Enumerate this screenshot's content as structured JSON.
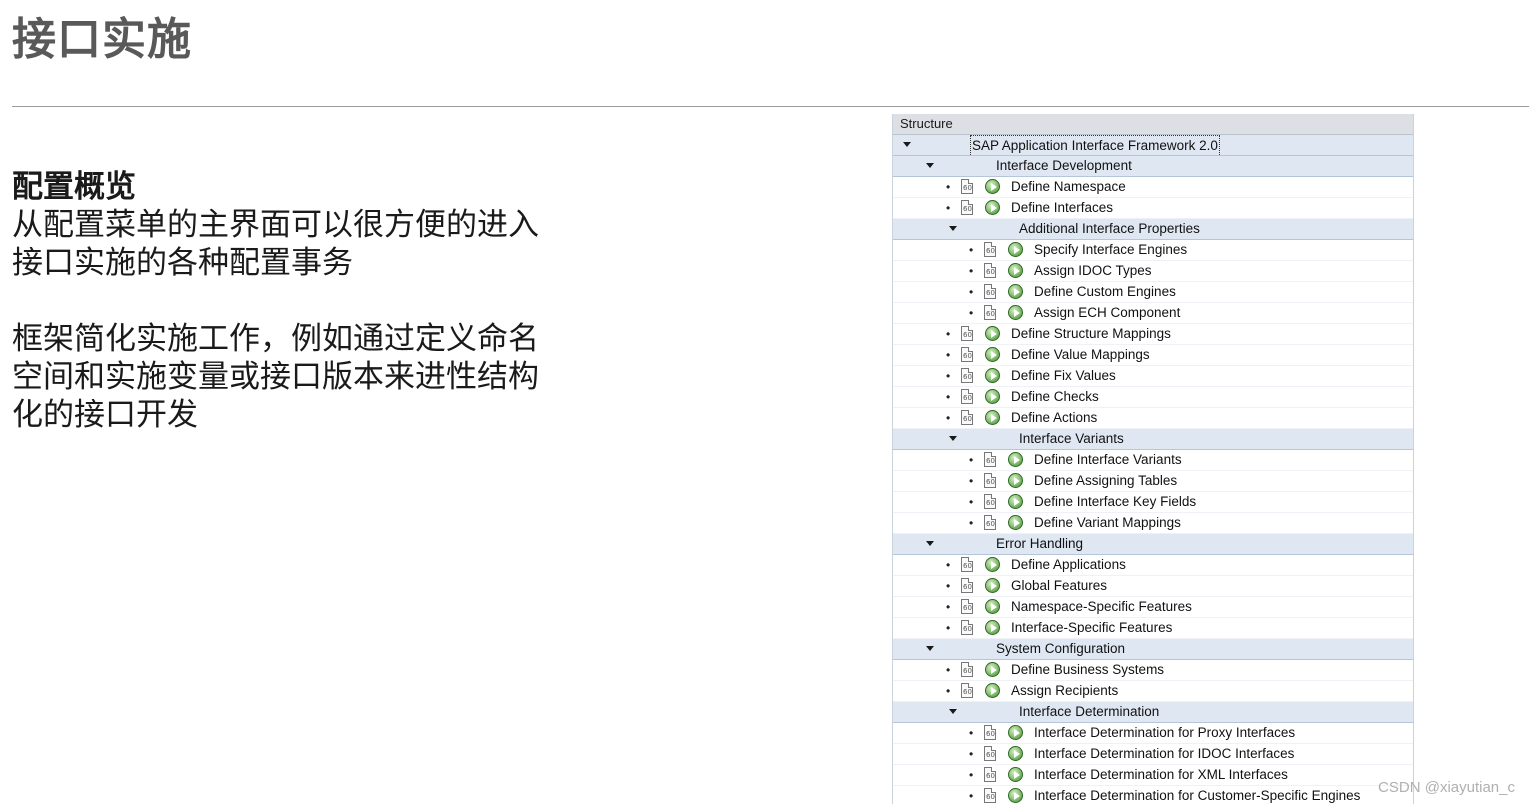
{
  "page": {
    "title": "接口实施",
    "section_heading": "配置概览",
    "paragraphs": [
      "从配置菜单的主界面可以很方便的进入接口实施的各种配置事务",
      "框架简化实施工作，例如通过定义命名空间和实施变量或接口版本来进性结构化的接口开发"
    ],
    "para_lines": [
      [
        "从配置菜单的主界面可以很方便的进入",
        "接口实施的各种配置事务"
      ],
      [
        "框架简化实施工作，例如通过定义命名",
        "空间和实施变量或接口版本来进性结构",
        "化的接口开发"
      ]
    ]
  },
  "tree": {
    "header": "Structure",
    "rows": [
      {
        "label": "SAP Application Interface Framework 2.0",
        "level": 0,
        "kind": "folder",
        "expanded": true
      },
      {
        "label": "Interface Development",
        "level": 1,
        "kind": "folder",
        "expanded": true
      },
      {
        "label": "Define Namespace",
        "level": 2,
        "kind": "item"
      },
      {
        "label": "Define Interfaces",
        "level": 2,
        "kind": "item"
      },
      {
        "label": "Additional Interface Properties",
        "level": 2,
        "kind": "folder",
        "expanded": true
      },
      {
        "label": "Specify Interface Engines",
        "level": 3,
        "kind": "item"
      },
      {
        "label": "Assign IDOC Types",
        "level": 3,
        "kind": "item"
      },
      {
        "label": "Define Custom Engines",
        "level": 3,
        "kind": "item"
      },
      {
        "label": "Assign ECH Component",
        "level": 3,
        "kind": "item"
      },
      {
        "label": "Define Structure Mappings",
        "level": 2,
        "kind": "item"
      },
      {
        "label": "Define Value Mappings",
        "level": 2,
        "kind": "item"
      },
      {
        "label": "Define Fix Values",
        "level": 2,
        "kind": "item"
      },
      {
        "label": "Define Checks",
        "level": 2,
        "kind": "item"
      },
      {
        "label": "Define Actions",
        "level": 2,
        "kind": "item"
      },
      {
        "label": "Interface Variants",
        "level": 2,
        "kind": "folder",
        "expanded": true
      },
      {
        "label": "Define Interface Variants",
        "level": 3,
        "kind": "item"
      },
      {
        "label": "Define Assigning Tables",
        "level": 3,
        "kind": "item"
      },
      {
        "label": "Define Interface Key Fields",
        "level": 3,
        "kind": "item"
      },
      {
        "label": "Define Variant Mappings",
        "level": 3,
        "kind": "item"
      },
      {
        "label": "Error Handling",
        "level": 1,
        "kind": "folder",
        "expanded": true
      },
      {
        "label": "Define Applications",
        "level": 2,
        "kind": "item"
      },
      {
        "label": "Global Features",
        "level": 2,
        "kind": "item"
      },
      {
        "label": "Namespace-Specific Features",
        "level": 2,
        "kind": "item"
      },
      {
        "label": "Interface-Specific Features",
        "level": 2,
        "kind": "item"
      },
      {
        "label": "System Configuration",
        "level": 1,
        "kind": "folder",
        "expanded": true
      },
      {
        "label": "Define Business Systems",
        "level": 2,
        "kind": "item"
      },
      {
        "label": "Assign Recipients",
        "level": 2,
        "kind": "item"
      },
      {
        "label": "Interface Determination",
        "level": 2,
        "kind": "folder",
        "expanded": true
      },
      {
        "label": "Interface Determination for Proxy Interfaces",
        "level": 3,
        "kind": "item"
      },
      {
        "label": "Interface Determination for IDOC Interfaces",
        "level": 3,
        "kind": "item"
      },
      {
        "label": "Interface Determination for XML Interfaces",
        "level": 3,
        "kind": "item"
      },
      {
        "label": "Interface Determination for Customer-Specific Engines",
        "level": 3,
        "kind": "item"
      }
    ]
  },
  "watermark": "CSDN @xiayutian_c",
  "colors": {
    "title": "#595959",
    "folder_row_bg": "#dfe8f2",
    "header_bg": "#dcdfe3",
    "exec_icon": "#3f8f2a"
  },
  "icons": {
    "folder_toggle": "triangle-down-icon",
    "doc": "document-icon",
    "execute": "execute-clock-icon"
  }
}
